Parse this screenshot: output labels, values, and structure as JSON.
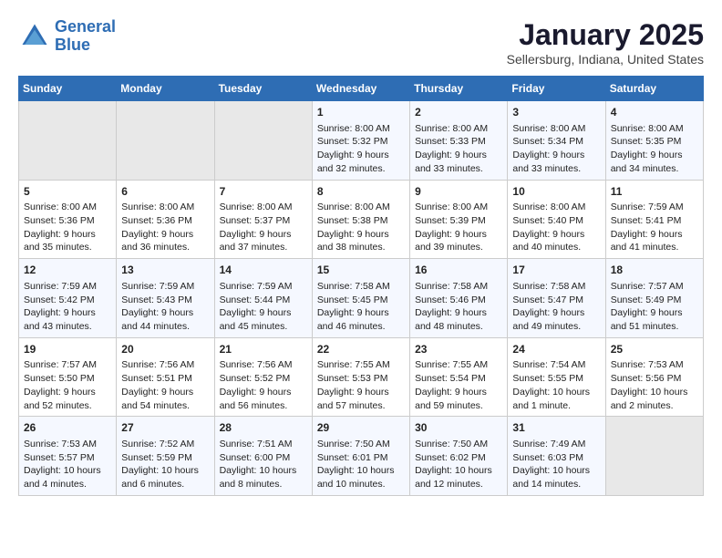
{
  "header": {
    "logo_line1": "General",
    "logo_line2": "Blue",
    "month": "January 2025",
    "location": "Sellersburg, Indiana, United States"
  },
  "days_of_week": [
    "Sunday",
    "Monday",
    "Tuesday",
    "Wednesday",
    "Thursday",
    "Friday",
    "Saturday"
  ],
  "weeks": [
    [
      {
        "day": "",
        "empty": true
      },
      {
        "day": "",
        "empty": true
      },
      {
        "day": "",
        "empty": true
      },
      {
        "day": "1",
        "sunrise": "Sunrise: 8:00 AM",
        "sunset": "Sunset: 5:32 PM",
        "daylight": "Daylight: 9 hours and 32 minutes."
      },
      {
        "day": "2",
        "sunrise": "Sunrise: 8:00 AM",
        "sunset": "Sunset: 5:33 PM",
        "daylight": "Daylight: 9 hours and 33 minutes."
      },
      {
        "day": "3",
        "sunrise": "Sunrise: 8:00 AM",
        "sunset": "Sunset: 5:34 PM",
        "daylight": "Daylight: 9 hours and 33 minutes."
      },
      {
        "day": "4",
        "sunrise": "Sunrise: 8:00 AM",
        "sunset": "Sunset: 5:35 PM",
        "daylight": "Daylight: 9 hours and 34 minutes."
      }
    ],
    [
      {
        "day": "5",
        "sunrise": "Sunrise: 8:00 AM",
        "sunset": "Sunset: 5:36 PM",
        "daylight": "Daylight: 9 hours and 35 minutes."
      },
      {
        "day": "6",
        "sunrise": "Sunrise: 8:00 AM",
        "sunset": "Sunset: 5:36 PM",
        "daylight": "Daylight: 9 hours and 36 minutes."
      },
      {
        "day": "7",
        "sunrise": "Sunrise: 8:00 AM",
        "sunset": "Sunset: 5:37 PM",
        "daylight": "Daylight: 9 hours and 37 minutes."
      },
      {
        "day": "8",
        "sunrise": "Sunrise: 8:00 AM",
        "sunset": "Sunset: 5:38 PM",
        "daylight": "Daylight: 9 hours and 38 minutes."
      },
      {
        "day": "9",
        "sunrise": "Sunrise: 8:00 AM",
        "sunset": "Sunset: 5:39 PM",
        "daylight": "Daylight: 9 hours and 39 minutes."
      },
      {
        "day": "10",
        "sunrise": "Sunrise: 8:00 AM",
        "sunset": "Sunset: 5:40 PM",
        "daylight": "Daylight: 9 hours and 40 minutes."
      },
      {
        "day": "11",
        "sunrise": "Sunrise: 7:59 AM",
        "sunset": "Sunset: 5:41 PM",
        "daylight": "Daylight: 9 hours and 41 minutes."
      }
    ],
    [
      {
        "day": "12",
        "sunrise": "Sunrise: 7:59 AM",
        "sunset": "Sunset: 5:42 PM",
        "daylight": "Daylight: 9 hours and 43 minutes."
      },
      {
        "day": "13",
        "sunrise": "Sunrise: 7:59 AM",
        "sunset": "Sunset: 5:43 PM",
        "daylight": "Daylight: 9 hours and 44 minutes."
      },
      {
        "day": "14",
        "sunrise": "Sunrise: 7:59 AM",
        "sunset": "Sunset: 5:44 PM",
        "daylight": "Daylight: 9 hours and 45 minutes."
      },
      {
        "day": "15",
        "sunrise": "Sunrise: 7:58 AM",
        "sunset": "Sunset: 5:45 PM",
        "daylight": "Daylight: 9 hours and 46 minutes."
      },
      {
        "day": "16",
        "sunrise": "Sunrise: 7:58 AM",
        "sunset": "Sunset: 5:46 PM",
        "daylight": "Daylight: 9 hours and 48 minutes."
      },
      {
        "day": "17",
        "sunrise": "Sunrise: 7:58 AM",
        "sunset": "Sunset: 5:47 PM",
        "daylight": "Daylight: 9 hours and 49 minutes."
      },
      {
        "day": "18",
        "sunrise": "Sunrise: 7:57 AM",
        "sunset": "Sunset: 5:49 PM",
        "daylight": "Daylight: 9 hours and 51 minutes."
      }
    ],
    [
      {
        "day": "19",
        "sunrise": "Sunrise: 7:57 AM",
        "sunset": "Sunset: 5:50 PM",
        "daylight": "Daylight: 9 hours and 52 minutes."
      },
      {
        "day": "20",
        "sunrise": "Sunrise: 7:56 AM",
        "sunset": "Sunset: 5:51 PM",
        "daylight": "Daylight: 9 hours and 54 minutes."
      },
      {
        "day": "21",
        "sunrise": "Sunrise: 7:56 AM",
        "sunset": "Sunset: 5:52 PM",
        "daylight": "Daylight: 9 hours and 56 minutes."
      },
      {
        "day": "22",
        "sunrise": "Sunrise: 7:55 AM",
        "sunset": "Sunset: 5:53 PM",
        "daylight": "Daylight: 9 hours and 57 minutes."
      },
      {
        "day": "23",
        "sunrise": "Sunrise: 7:55 AM",
        "sunset": "Sunset: 5:54 PM",
        "daylight": "Daylight: 9 hours and 59 minutes."
      },
      {
        "day": "24",
        "sunrise": "Sunrise: 7:54 AM",
        "sunset": "Sunset: 5:55 PM",
        "daylight": "Daylight: 10 hours and 1 minute."
      },
      {
        "day": "25",
        "sunrise": "Sunrise: 7:53 AM",
        "sunset": "Sunset: 5:56 PM",
        "daylight": "Daylight: 10 hours and 2 minutes."
      }
    ],
    [
      {
        "day": "26",
        "sunrise": "Sunrise: 7:53 AM",
        "sunset": "Sunset: 5:57 PM",
        "daylight": "Daylight: 10 hours and 4 minutes."
      },
      {
        "day": "27",
        "sunrise": "Sunrise: 7:52 AM",
        "sunset": "Sunset: 5:59 PM",
        "daylight": "Daylight: 10 hours and 6 minutes."
      },
      {
        "day": "28",
        "sunrise": "Sunrise: 7:51 AM",
        "sunset": "Sunset: 6:00 PM",
        "daylight": "Daylight: 10 hours and 8 minutes."
      },
      {
        "day": "29",
        "sunrise": "Sunrise: 7:50 AM",
        "sunset": "Sunset: 6:01 PM",
        "daylight": "Daylight: 10 hours and 10 minutes."
      },
      {
        "day": "30",
        "sunrise": "Sunrise: 7:50 AM",
        "sunset": "Sunset: 6:02 PM",
        "daylight": "Daylight: 10 hours and 12 minutes."
      },
      {
        "day": "31",
        "sunrise": "Sunrise: 7:49 AM",
        "sunset": "Sunset: 6:03 PM",
        "daylight": "Daylight: 10 hours and 14 minutes."
      },
      {
        "day": "",
        "empty": true
      }
    ]
  ]
}
